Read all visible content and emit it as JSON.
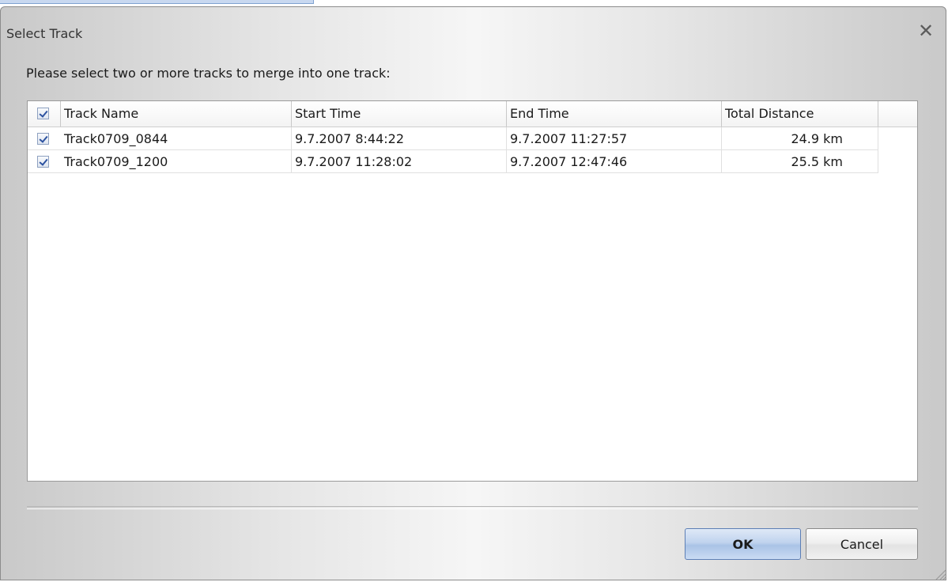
{
  "window": {
    "title": "Select Track",
    "close_symbol": "✕"
  },
  "prompt": "Please select two or more tracks to merge into one track:",
  "table": {
    "select_all_checked": true,
    "columns": [
      "Track Name",
      "Start Time",
      "End Time",
      "Total Distance"
    ],
    "rows": [
      {
        "checked": true,
        "name": "Track0709_0844",
        "start": "9.7.2007 8:44:22",
        "end": "9.7.2007 11:27:57",
        "distance": "24.9 km"
      },
      {
        "checked": true,
        "name": "Track0709_1200",
        "start": "9.7.2007 11:28:02",
        "end": "9.7.2007 12:47:46",
        "distance": "25.5 km"
      }
    ]
  },
  "buttons": {
    "ok_label": "OK",
    "cancel_label": "Cancel"
  },
  "colors": {
    "accent": "#2c52a0",
    "ok_button": "#c0d3ee"
  }
}
